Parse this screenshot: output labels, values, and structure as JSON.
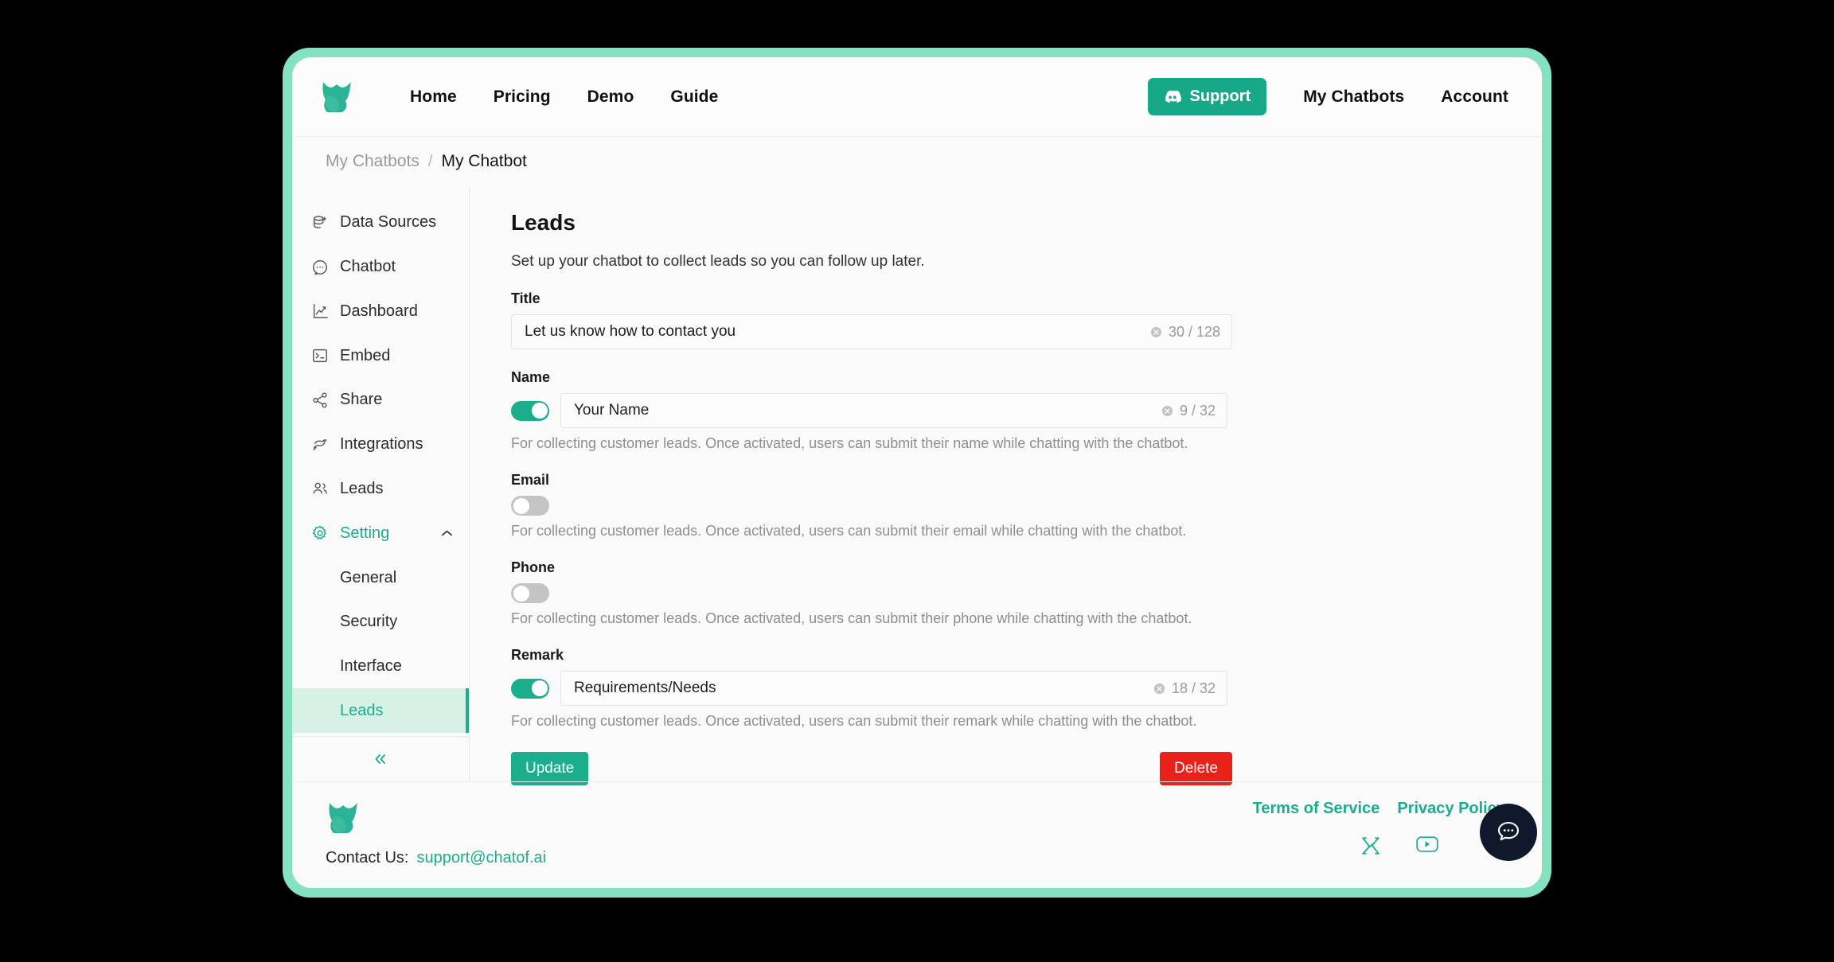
{
  "brand": {
    "accent": "#1aae8c",
    "accent_dark": "#17a888",
    "frame": "#85e2c1",
    "danger": "#ea2118",
    "logo_icon": "chatof-star-logo"
  },
  "topnav": {
    "logo_icon": "chatof-logo-icon",
    "links": [
      {
        "label": "Home"
      },
      {
        "label": "Pricing"
      },
      {
        "label": "Demo"
      },
      {
        "label": "Guide"
      }
    ],
    "support": {
      "label": "Support",
      "icon": "discord-icon"
    },
    "right_links": [
      {
        "label": "My Chatbots"
      },
      {
        "label": "Account"
      }
    ]
  },
  "breadcrumb": {
    "parent": "My Chatbots",
    "separator": "/",
    "current": "My Chatbot"
  },
  "sidebar": {
    "items": [
      {
        "label": "Data Sources",
        "icon": "database-plus-icon",
        "active": false
      },
      {
        "label": "Chatbot",
        "icon": "chat-bubble-icon",
        "active": false
      },
      {
        "label": "Dashboard",
        "icon": "line-chart-icon",
        "active": false
      },
      {
        "label": "Embed",
        "icon": "terminal-icon",
        "active": false
      },
      {
        "label": "Share",
        "icon": "share-nodes-icon",
        "active": false
      },
      {
        "label": "Integrations",
        "icon": "integrations-icon",
        "active": false
      },
      {
        "label": "Leads",
        "icon": "users-icon",
        "active": false
      },
      {
        "label": "Setting",
        "icon": "gear-icon",
        "active": true,
        "expanded": true,
        "chevron": "chevron-up-icon"
      }
    ],
    "sub_items": [
      {
        "label": "General",
        "active": false
      },
      {
        "label": "Security",
        "active": false
      },
      {
        "label": "Interface",
        "active": false
      },
      {
        "label": "Leads",
        "active": true
      }
    ],
    "collapse_icon": "chevron-double-left-icon"
  },
  "main": {
    "title": "Leads",
    "subtitle": "Set up your chatbot to collect leads so you can follow up later.",
    "fields": {
      "title": {
        "label": "Title",
        "value": "Let us know how to contact you",
        "counter": "30 / 128",
        "clear_icon": "clear-circle-icon",
        "has_toggle": false
      },
      "name": {
        "label": "Name",
        "toggle_on": true,
        "value": "Your Name",
        "counter": "9 / 32",
        "clear_icon": "clear-circle-icon",
        "helper": "For collecting customer leads. Once activated, users can submit their name while chatting with the chatbot."
      },
      "email": {
        "label": "Email",
        "toggle_on": false,
        "helper": "For collecting customer leads. Once activated, users can submit their email while chatting with the chatbot."
      },
      "phone": {
        "label": "Phone",
        "toggle_on": false,
        "helper": "For collecting customer leads. Once activated, users can submit their phone while chatting with the chatbot."
      },
      "remark": {
        "label": "Remark",
        "toggle_on": true,
        "value": "Requirements/Needs",
        "counter": "18 / 32",
        "clear_icon": "clear-circle-icon",
        "helper": "For collecting customer leads. Once activated, users can submit their remark while chatting with the chatbot."
      }
    },
    "buttons": {
      "update": "Update",
      "delete": "Delete"
    }
  },
  "footer": {
    "logo_icon": "chatof-logo-icon",
    "contact_label": "Contact Us:",
    "contact_email": "support@chatof.ai",
    "links": [
      {
        "label": "Terms of Service"
      },
      {
        "label": "Privacy Policy"
      }
    ],
    "socials": [
      {
        "icon": "x-twitter-icon"
      },
      {
        "icon": "youtube-icon"
      }
    ]
  },
  "chat_widget": {
    "icon": "chat-dots-icon"
  }
}
